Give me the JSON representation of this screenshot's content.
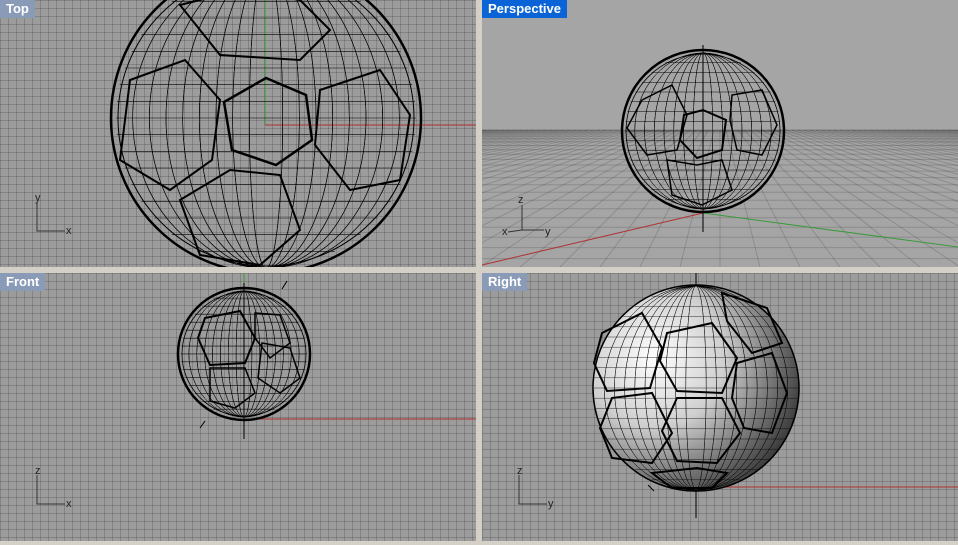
{
  "viewports": {
    "top": {
      "label": "Top",
      "axis_h": "x",
      "axis_v": "y"
    },
    "perspective": {
      "label": "Perspective",
      "axis_a": "x",
      "axis_b": "y",
      "axis_c": "z"
    },
    "front": {
      "label": "Front",
      "axis_h": "x",
      "axis_v": "z"
    },
    "right": {
      "label": "Right",
      "axis_h": "y",
      "axis_v": "z"
    }
  },
  "active_viewport": "perspective",
  "colors": {
    "grid_bg": "#9c9c9c",
    "x_axis": "#b03030",
    "y_axis": "#3a9a3a",
    "wire": "#000000",
    "active_label": "#0a64d8",
    "inactive_label": "#8a9bb8"
  }
}
